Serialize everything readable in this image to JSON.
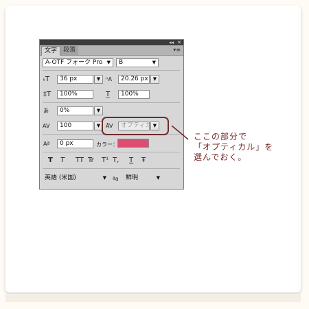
{
  "panel": {
    "tabs": [
      {
        "label": "文字",
        "active": true
      },
      {
        "label": "段落",
        "active": false
      }
    ],
    "titlebar": {
      "collapse_glyph": "◂◂",
      "close_glyph": "✕"
    },
    "menu_glyph": "▾≡",
    "font_family": "A-OTF フォーク Pro",
    "font_style": "B",
    "font_size": "36 px",
    "leading": "20.26 px",
    "vertical_scale": "100%",
    "horizontal_scale": "100%",
    "tsume": "0%",
    "tracking": "100",
    "kerning": "オプティカル",
    "baseline_shift": "0 px",
    "color_label": "カラー：",
    "color_value": "#dc4e71",
    "style_buttons": [
      "T",
      "T",
      "TT",
      "Tr",
      "T¹",
      "T,",
      "T",
      "Ŧ"
    ],
    "language": "英語 (米国)",
    "aa_label": "ªa",
    "antialias": "鮮明"
  },
  "annotation": {
    "lines": [
      "ここの部分で",
      "「オプティカル」を",
      "選んでおく。"
    ],
    "color": "#7a2a2a"
  }
}
